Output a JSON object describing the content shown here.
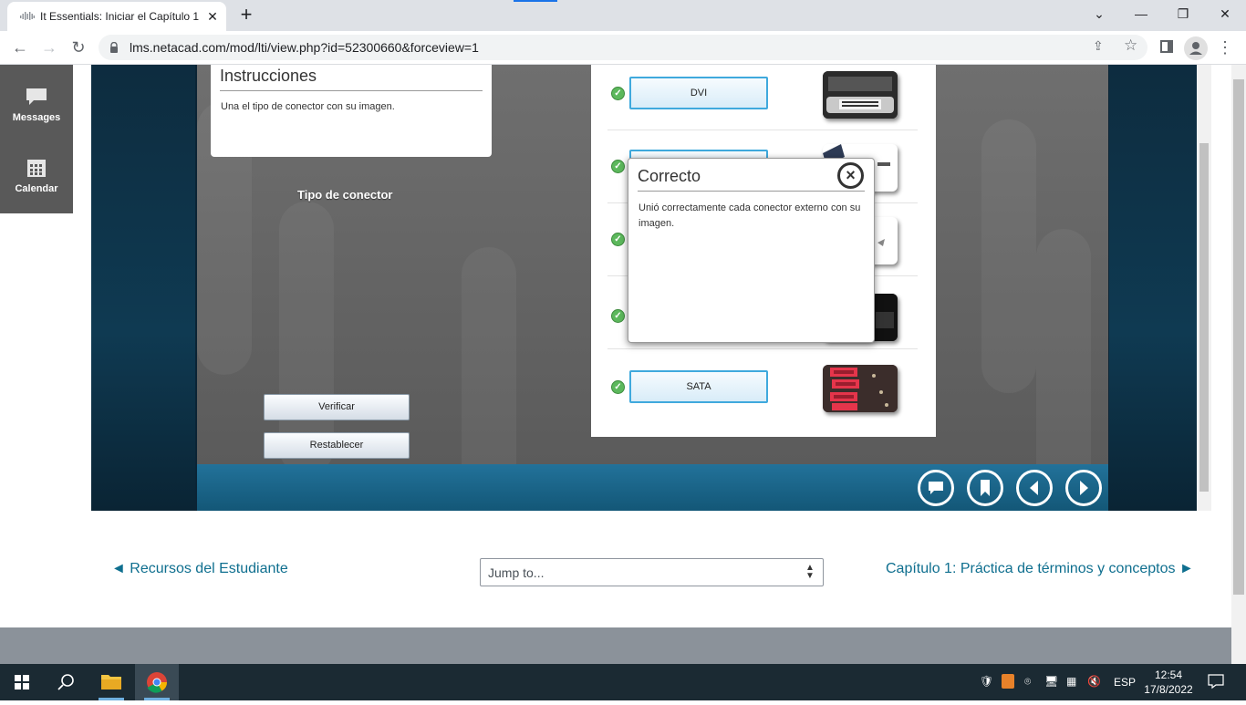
{
  "browser": {
    "tab_title": "It Essentials: Iniciar el Capítulo 1",
    "tab_close": "✕",
    "new_tab": "+",
    "url": "lms.netacad.com/mod/lti/view.php?id=52300660&forceview=1",
    "window_controls": {
      "collapse": "⌄",
      "minimize": "—",
      "restore": "❐",
      "close": "✕"
    }
  },
  "drawer": {
    "items": [
      {
        "label": "Messages",
        "icon": "chat-bubble-icon"
      },
      {
        "label": "Calendar",
        "icon": "calendar-icon"
      }
    ]
  },
  "activity": {
    "instructions_title": "Instrucciones",
    "instructions_text": "Una el tipo de conector con su imagen.",
    "column_title": "Tipo de conector",
    "verify_button": "Verificar",
    "reset_button": "Restablecer",
    "rows": [
      {
        "label": "DVI",
        "status": "correct"
      },
      {
        "label": "",
        "status": "correct"
      },
      {
        "label": "",
        "status": "correct"
      },
      {
        "label": "",
        "status": "correct"
      },
      {
        "label": "SATA",
        "status": "correct"
      }
    ],
    "dialog": {
      "title": "Correcto",
      "text": "Unió correctamente cada conector externo con su imagen."
    },
    "nav_buttons": [
      "comment-icon",
      "bookmark-icon",
      "previous-icon",
      "next-icon"
    ]
  },
  "course_nav": {
    "prev_link": "◄ Recursos del Estudiante",
    "jump_placeholder": "Jump to...",
    "next_link": "Capítulo 1: Práctica de términos y conceptos ►"
  },
  "taskbar": {
    "language": "ESP",
    "time": "12:54",
    "date": "17/8/2022"
  }
}
